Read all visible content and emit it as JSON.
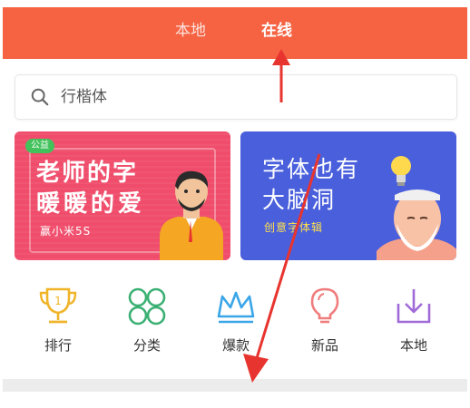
{
  "header": {
    "tabs": [
      {
        "label": "本地",
        "active": false
      },
      {
        "label": "在线",
        "active": true
      }
    ],
    "background": "#f56342"
  },
  "search": {
    "placeholder": "行楷体",
    "icon": "search-icon"
  },
  "banners": [
    {
      "badge": "公益",
      "line1": "老师的字",
      "line2": "暖暖的爱",
      "subtitle": "赢小米5S",
      "background": "#ef4d6b"
    },
    {
      "line1": "字体也有",
      "line2": "大脑洞",
      "subtitle": "创意字体辑",
      "background": "#4a5fdc"
    }
  ],
  "categories": [
    {
      "label": "排行",
      "icon": "trophy-icon",
      "color": "#f0b429"
    },
    {
      "label": "分类",
      "icon": "four-circles-icon",
      "color": "#3bb073"
    },
    {
      "label": "爆款",
      "icon": "crown-icon",
      "color": "#3aa6e8"
    },
    {
      "label": "新品",
      "icon": "lightbulb-icon",
      "color": "#f07c7c"
    },
    {
      "label": "本地",
      "icon": "download-box-icon",
      "color": "#a06ad8"
    }
  ],
  "annotation_color": "#e8342f"
}
